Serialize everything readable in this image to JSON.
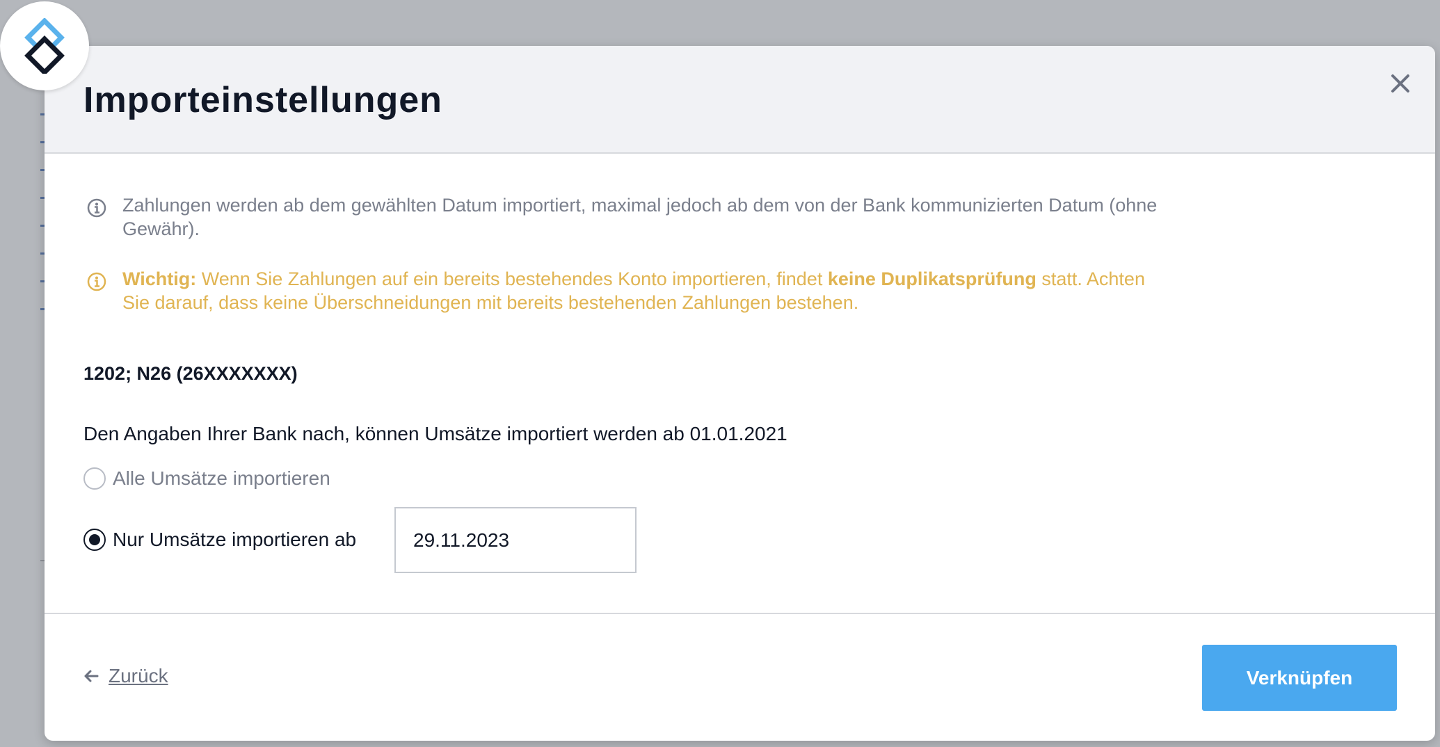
{
  "modal": {
    "title": "Importeinstellungen",
    "close_icon": "close-icon"
  },
  "notices": {
    "info_icon": "info-circle-icon",
    "info_text": "Zahlungen werden ab dem gewählten Datum importiert, maximal jedoch ab dem von der Bank kommunizierten Datum (ohne Gewähr).",
    "warning_icon": "info-circle-icon",
    "warning_label": "Wichtig:",
    "warning_text_1": " Wenn Sie Zahlungen auf ein bereits bestehendes Konto importieren, findet ",
    "warning_emphasis": "keine Duplikatsprüfung",
    "warning_text_2": " statt. Achten Sie darauf, dass keine Überschneidungen mit bereits bestehenden Zahlungen bestehen."
  },
  "account": {
    "name": "1202; N26 (26XXXXXXX)",
    "bank_info": "Den Angaben Ihrer Bank nach, können Umsätze importiert werden ab 01.01.2021"
  },
  "options": {
    "all_label": "Alle Umsätze importieren",
    "all_selected": false,
    "from_label": "Nur Umsätze importieren ab",
    "from_selected": true,
    "from_date": "29.11.2023"
  },
  "footer": {
    "back_label": "Zurück",
    "back_icon": "arrow-left-icon",
    "submit_label": "Verknüpfen"
  },
  "colors": {
    "primary": "#4aa8ef",
    "warning": "#e0b452",
    "muted": "#7a7f8c",
    "header_bg": "#f1f2f5"
  }
}
